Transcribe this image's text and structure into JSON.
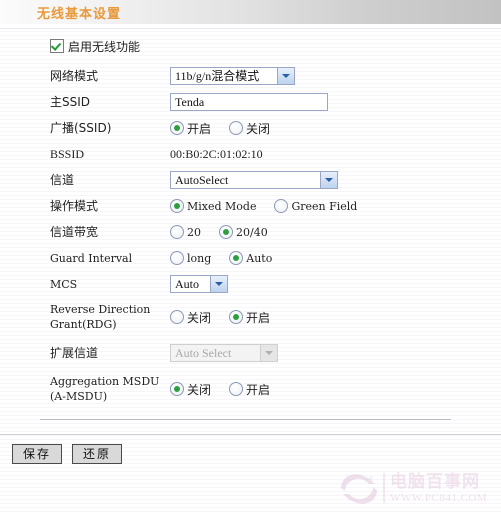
{
  "header": {
    "title": "无线基本设置"
  },
  "enable_wireless": {
    "label": "启用无线功能",
    "checked": true,
    "icon": "checkbox-checked-icon"
  },
  "fields": {
    "network_mode": {
      "label": "网络模式",
      "value": "11b/g/n混合模式",
      "arrow_icon": "chevron-down-icon"
    },
    "main_ssid": {
      "label": "主SSID",
      "value": "Tenda",
      "placeholder": ""
    },
    "broadcast_ssid": {
      "label": "广播(SSID)",
      "options": [
        "开启",
        "关闭"
      ],
      "selected": "开启"
    },
    "bssid": {
      "label": "BSSID",
      "value": "00:B0:2C:01:02:10"
    },
    "channel": {
      "label": "信道",
      "value": "AutoSelect",
      "arrow_icon": "chevron-down-icon"
    },
    "operation_mode": {
      "label": "操作模式",
      "options": [
        "Mixed Mode",
        "Green Field"
      ],
      "selected": "Mixed Mode"
    },
    "channel_bandwidth": {
      "label": "信道带宽",
      "options": [
        "20",
        "20/40"
      ],
      "selected": "20/40"
    },
    "guard_interval": {
      "label": "Guard Interval",
      "options": [
        "long",
        "Auto"
      ],
      "selected": "Auto"
    },
    "mcs": {
      "label": "MCS",
      "value": "Auto",
      "arrow_icon": "chevron-down-icon"
    },
    "rdg": {
      "label": "Reverse Direction\nGrant(RDG)",
      "options": [
        "关闭",
        "开启"
      ],
      "selected": "开启"
    },
    "extension_channel": {
      "label": "扩展信道",
      "value": "Auto Select",
      "disabled": true,
      "arrow_icon": "chevron-down-icon"
    },
    "amsdu": {
      "label": "Aggregation MSDU\n(A-MSDU)",
      "options": [
        "关闭",
        "开启"
      ],
      "selected": "关闭"
    }
  },
  "buttons": {
    "save": "保存",
    "restore": "还原"
  },
  "watermark": {
    "main": "电脑百事网",
    "sub": "WWW.PC841.COM"
  }
}
